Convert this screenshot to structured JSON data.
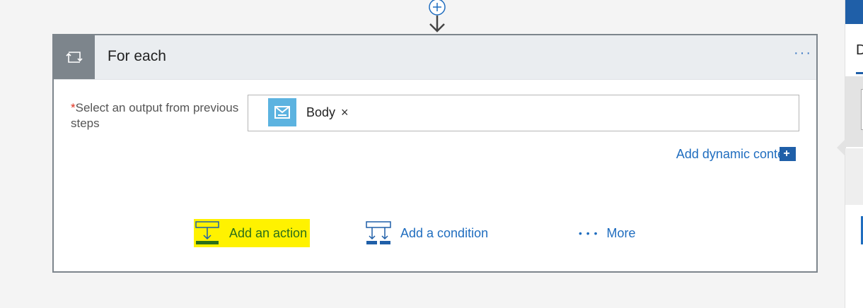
{
  "foreach_card": {
    "title": "For each",
    "menu_label": "···",
    "field": {
      "required_marker": "*",
      "label": "Select an output from previous steps"
    },
    "token": {
      "label": "Body",
      "remove_label": "×"
    },
    "dynamic_content_label": "Add dynamic content",
    "dynamic_content_icon": "+"
  },
  "actions": {
    "add_action": "Add an action",
    "add_condition": "Add a condition",
    "more": "More",
    "more_dots": "• • •"
  },
  "right_panel": {
    "tab_initial": "D"
  },
  "colors": {
    "accent": "#1f6dbf",
    "header_tile": "#7d858c",
    "token_icon_bg": "#5cb3e0",
    "highlight": "#fff200"
  },
  "icons": {
    "connector": "add-step-plus-arrow-icon",
    "loop": "loop-icon",
    "token": "outlook-mail-icon",
    "add_action": "add-action-icon",
    "add_condition": "add-condition-icon"
  }
}
